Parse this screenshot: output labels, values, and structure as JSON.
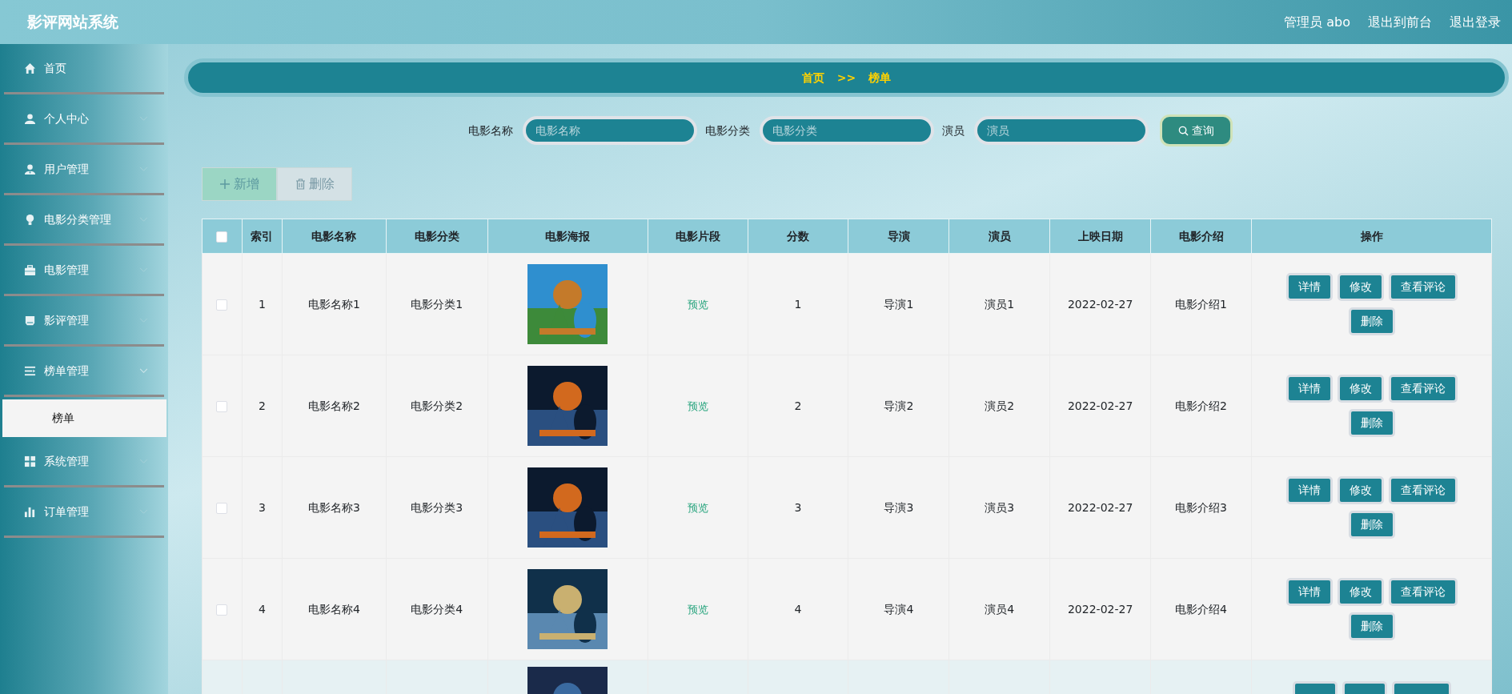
{
  "header": {
    "title": "影评网站系统",
    "links": [
      "管理员 abo",
      "退出到前台",
      "退出登录"
    ]
  },
  "sidebar": {
    "items": [
      {
        "label": "首页",
        "kind": "link"
      },
      {
        "label": "个人中心",
        "kind": "menu",
        "expanded": false
      },
      {
        "label": "用户管理",
        "kind": "menu",
        "expanded": false
      },
      {
        "label": "电影分类管理",
        "kind": "menu",
        "expanded": false
      },
      {
        "label": "电影管理",
        "kind": "menu",
        "expanded": false
      },
      {
        "label": "影评管理",
        "kind": "menu",
        "expanded": false
      },
      {
        "label": "榜单管理",
        "kind": "menu",
        "expanded": true,
        "children": [
          {
            "label": "榜单",
            "selected": true
          }
        ]
      },
      {
        "label": "系统管理",
        "kind": "menu",
        "expanded": false
      },
      {
        "label": "订单管理",
        "kind": "menu",
        "expanded": false
      }
    ]
  },
  "breadcrumb": [
    "首页",
    ">>",
    "榜单"
  ],
  "search": {
    "fields": [
      {
        "label": "电影名称",
        "placeholder": "电影名称"
      },
      {
        "label": "电影分类",
        "placeholder": "电影分类"
      },
      {
        "label": "演员",
        "placeholder": "演员"
      }
    ],
    "button": "查询"
  },
  "toolbar": [
    {
      "label": "新增",
      "kind": "add",
      "disabled": true
    },
    {
      "label": "删除",
      "kind": "delete",
      "disabled": true
    }
  ],
  "table": {
    "columns": [
      "索引",
      "电影名称",
      "电影分类",
      "电影海报",
      "电影片段",
      "分数",
      "导演",
      "演员",
      "上映日期",
      "电影介绍",
      "操作"
    ],
    "header_checked": false,
    "rows": [
      {
        "checked": false,
        "cells": [
          "1",
          "电影名称1",
          "电影分类1"
        ],
        "clip": "预览",
        "rest": [
          "1",
          "导演1",
          "演员1",
          "2022-02-27",
          "电影介绍1"
        ],
        "actions": [
          "详情",
          "修改",
          "查看评论",
          "删除"
        ]
      },
      {
        "checked": false,
        "cells": [
          "2",
          "电影名称2",
          "电影分类2"
        ],
        "clip": "预览",
        "rest": [
          "2",
          "导演2",
          "演员2",
          "2022-02-27",
          "电影介绍2"
        ],
        "actions": [
          "详情",
          "修改",
          "查看评论",
          "删除"
        ]
      },
      {
        "checked": false,
        "cells": [
          "3",
          "电影名称3",
          "电影分类3"
        ],
        "clip": "预览",
        "rest": [
          "3",
          "导演3",
          "演员3",
          "2022-02-27",
          "电影介绍3"
        ],
        "actions": [
          "详情",
          "修改",
          "查看评论",
          "删除"
        ]
      },
      {
        "checked": false,
        "cells": [
          "4",
          "电影名称4",
          "电影分类4"
        ],
        "clip": "预览",
        "rest": [
          "4",
          "导演4",
          "演员4",
          "2022-02-27",
          "电影介绍4"
        ],
        "actions": [
          "详情",
          "修改",
          "查看评论",
          "删除"
        ]
      },
      {
        "kind": "cut"
      }
    ]
  }
}
